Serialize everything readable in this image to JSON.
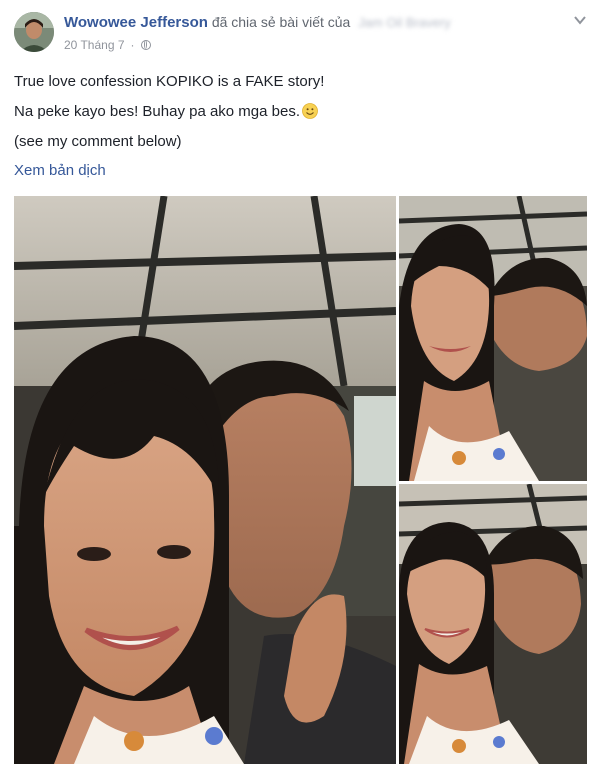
{
  "post": {
    "author": "Wowowee Jefferson",
    "shared_text": "đã chia sẻ bài viết của",
    "shared_from_blurred": "Jam Oil Bravery",
    "date": "20 Tháng 7",
    "dot": "·",
    "menu_icon": "chevron-down-icon",
    "lines": [
      "True love confession KOPIKO is a FAKE story!",
      "Na peke kayo bes! Buhay pa ako mga bes.",
      "(see my comment below)"
    ],
    "translate_link": "Xem bản dịch"
  },
  "photos": [
    {
      "name": "selfie-main"
    },
    {
      "name": "selfie-top-right"
    },
    {
      "name": "selfie-bottom-right"
    }
  ],
  "colors": {
    "author": "#365899",
    "meta": "#90949c",
    "text": "#1d2129",
    "link": "#365899"
  }
}
